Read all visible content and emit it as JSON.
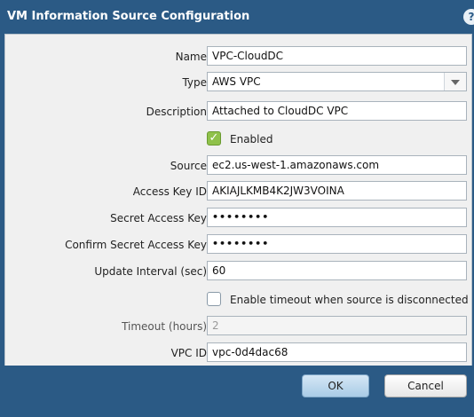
{
  "dialog": {
    "title": "VM Information Source Configuration",
    "help_label": "?"
  },
  "form": {
    "name": {
      "label": "Name",
      "value": "VPC-CloudDC"
    },
    "type": {
      "label": "Type",
      "value": "AWS VPC"
    },
    "description": {
      "label": "Description",
      "value": "Attached to CloudDC VPC"
    },
    "enabled": {
      "label": "Enabled",
      "checked": true,
      "mark": "✓"
    },
    "source": {
      "label": "Source",
      "value": "ec2.us-west-1.amazonaws.com"
    },
    "access_key_id": {
      "label": "Access Key ID",
      "value": "AKIAJLKMB4K2JW3VOINA"
    },
    "secret_access_key": {
      "label": "Secret Access Key",
      "value": "••••••••"
    },
    "confirm_secret_access_key": {
      "label": "Confirm Secret Access Key",
      "value": "••••••••"
    },
    "update_interval": {
      "label": "Update Interval (sec)",
      "value": "60"
    },
    "enable_timeout": {
      "label": "Enable timeout when source is disconnected",
      "checked": false
    },
    "timeout": {
      "label": "Timeout (hours)",
      "value": "2"
    },
    "vpc_id": {
      "label": "VPC ID",
      "value": "vpc-0d4dac68"
    }
  },
  "buttons": {
    "ok": "OK",
    "cancel": "Cancel"
  },
  "colors": {
    "titlebar": "#2b5a85",
    "panel": "#f0f0f0",
    "checkbox_checked": "#8fc14a"
  }
}
